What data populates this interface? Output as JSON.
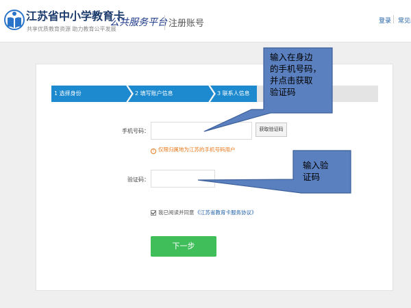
{
  "header": {
    "brand_title": "江苏省中小学教育卡",
    "brand_subtitle": "共享优质教育资源   助力教育公平发展",
    "brand_slogan": "公共服务平台",
    "page_title": "注册账号",
    "login_link": "登录",
    "faq_link": "常见问",
    "brand_color": "#1a3a6b"
  },
  "steps": {
    "items": [
      {
        "label": "1 选择身份"
      },
      {
        "label": "2 填写账户信息"
      },
      {
        "label": "3 联系人信息"
      }
    ],
    "active_color": "#1d8ad0",
    "inactive_color": "#e4e4e4"
  },
  "form": {
    "phone_label": "手机号码：",
    "phone_value": "",
    "get_code_button": "获取验证码",
    "phone_warning": "仅限归属地为江苏的手机号码用户",
    "code_label": "验证码：",
    "code_value": "",
    "agree_text": "我已阅读并同意",
    "agree_link": "《江苏省教育卡服务协议》",
    "agree_checked": true,
    "next_button": "下一步",
    "next_color": "#3fbe5a",
    "warning_color": "#e8771a"
  },
  "callouts": {
    "phone_note": [
      "输入在身边",
      "的手机号码，",
      "并点击获取",
      "验证码"
    ],
    "code_note": [
      "输入验",
      "证码"
    ],
    "fill_color": "#5b80bf"
  },
  "icons": {
    "logo": "book-person-icon",
    "warning": "exclamation-circle-icon",
    "check": "checkmark-icon"
  }
}
